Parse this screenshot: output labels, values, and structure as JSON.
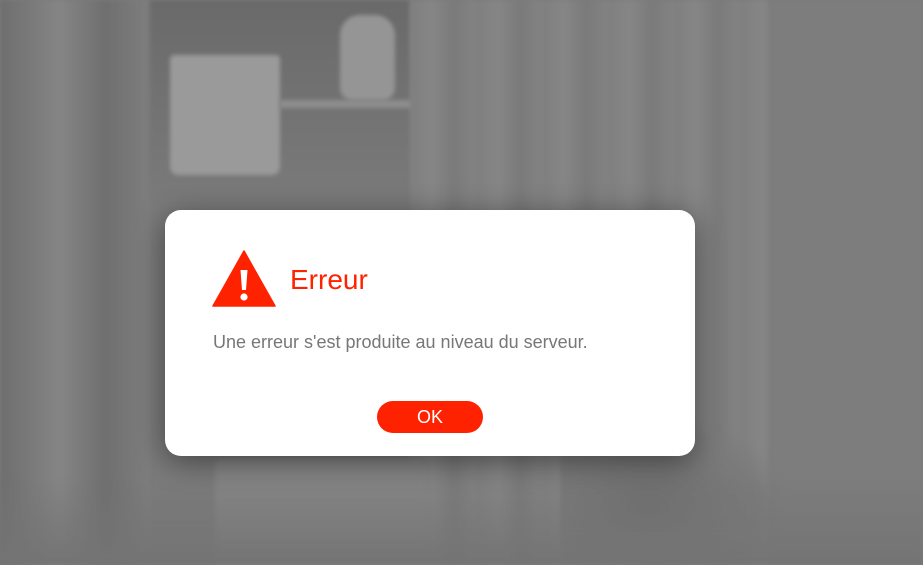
{
  "dialog": {
    "title": "Erreur",
    "message": "Une erreur s'est produite au niveau du serveur.",
    "icon": "warning-icon",
    "ok_label": "OK"
  },
  "colors": {
    "accent": "#ff2200",
    "message_text": "#777777",
    "dialog_bg": "#ffffff",
    "backdrop": "#7b7b7b"
  }
}
